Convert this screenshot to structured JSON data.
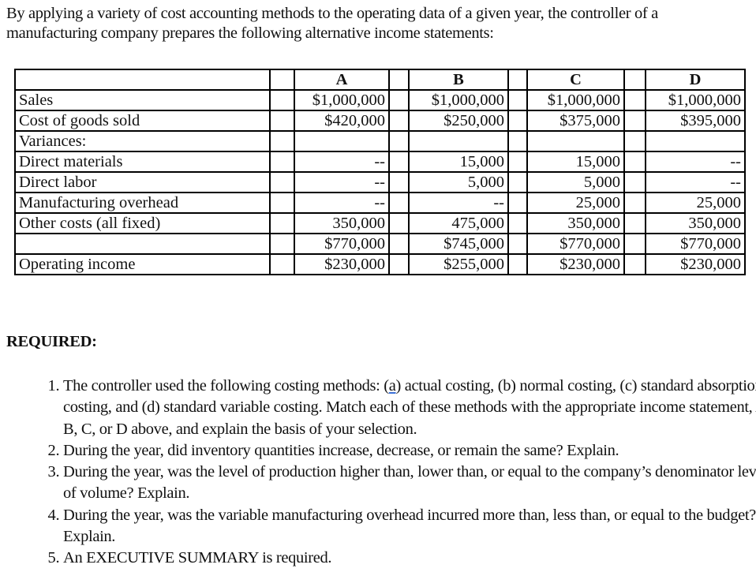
{
  "intro": "By applying a variety of cost accounting methods to the operating data of a given year, the controller of a manufacturing company prepares the following alternative income statements:",
  "table": {
    "columns": [
      "A",
      "B",
      "C",
      "D"
    ],
    "rows": [
      {
        "label": "Sales",
        "indent": false,
        "values": [
          "$1,000,000",
          "$1,000,000",
          "$1,000,000",
          "$1,000,000"
        ]
      },
      {
        "label": "Cost of goods sold",
        "indent": false,
        "values": [
          "$420,000",
          "$250,000",
          "$375,000",
          "$395,000"
        ]
      },
      {
        "label": "Variances:",
        "indent": false,
        "values": [
          "",
          "",
          "",
          ""
        ]
      },
      {
        "label": "Direct materials",
        "indent": true,
        "values": [
          "--",
          "15,000",
          "15,000",
          "--"
        ]
      },
      {
        "label": "Direct labor",
        "indent": true,
        "values": [
          "--",
          "5,000",
          "5,000",
          "--"
        ]
      },
      {
        "label": "Manufacturing overhead",
        "indent": true,
        "values": [
          "--",
          "--",
          "25,000",
          "25,000"
        ]
      },
      {
        "label": "Other costs (all fixed)",
        "indent": false,
        "values": [
          "350,000",
          "475,000",
          "350,000",
          "350,000"
        ]
      },
      {
        "label": "",
        "indent": false,
        "values": [
          "$770,000",
          "$745,000",
          "$770,000",
          "$770,000"
        ]
      },
      {
        "label": "Operating income",
        "indent": false,
        "values": [
          "$230,000",
          "$255,000",
          "$230,000",
          "$230,000"
        ]
      }
    ]
  },
  "required": {
    "heading": "REQUIRED:",
    "questions": [
      {
        "pre": "The controller used the following costing methods: (",
        "marked": "a",
        "post": ") actual costing, (b) normal costing, (c) standard absorption costing, and (d) standard variable costing. Match each of these methods with the appropriate income statement, A, B, C, or D above, and explain the basis of your selection."
      },
      {
        "pre": "During the year, did inventory quantities increase, decrease, or remain the same? Explain.",
        "marked": "",
        "post": ""
      },
      {
        "pre": "During the year, was the level of production higher than, lower than, or equal to the company’s denominator level of volume? Explain.",
        "marked": "",
        "post": ""
      },
      {
        "pre": "During the year, was the variable manufacturing overhead incurred more than, less than, or equal to the budget? Explain.",
        "marked": "",
        "post": ""
      },
      {
        "pre": "An EXECUTIVE SUMMARY is required.",
        "marked": "",
        "post": ""
      }
    ]
  }
}
